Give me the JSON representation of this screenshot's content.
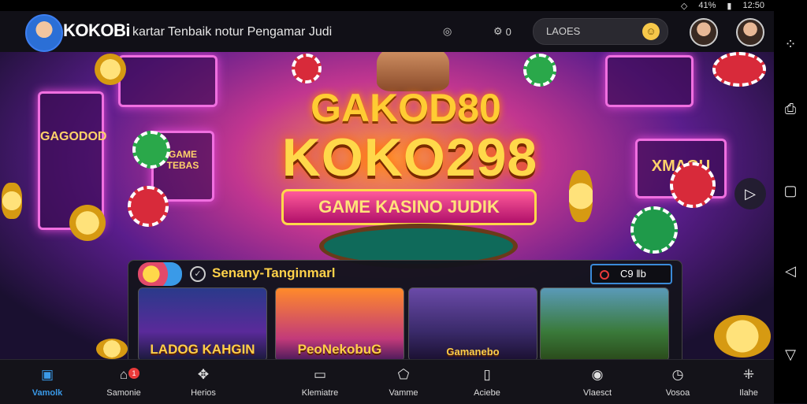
{
  "status": {
    "time": "12:50",
    "battery": "41%"
  },
  "header": {
    "brand": "KOKOBi",
    "tagline": "kartar Tenbaik notur Pengamar Judi",
    "icon1_name": "location-icon",
    "icon2_name": "settings-icon",
    "icon2_value": "0",
    "search_placeholder": "LAOES"
  },
  "hero": {
    "title_small": "GAKOD80",
    "title_big": "KOKO298",
    "subtitle": "GAME KASINO JUDIK",
    "sign_left": "GAGODOD",
    "sign_mid": "GAME TEBAS",
    "sign_right": "XMAGU"
  },
  "games": {
    "section_title": "Senany-Tanginmarl",
    "counter_text": "C9 ǁb",
    "cards": [
      {
        "label": "LADOG KAHGIN"
      },
      {
        "label": "PeoNekobuG"
      },
      {
        "label": "Gamanebo"
      },
      {
        "label": ""
      }
    ]
  },
  "nav": [
    {
      "label": "Vamolk",
      "icon": "home-icon",
      "active": true
    },
    {
      "label": "Samonie",
      "icon": "notification-icon",
      "badge": "1"
    },
    {
      "label": "Herios",
      "icon": "games-icon"
    },
    {
      "label": "Klemiatre",
      "icon": "chat-icon"
    },
    {
      "label": "Vamme",
      "icon": "bookmark-icon"
    },
    {
      "label": "Aciebe",
      "icon": "document-icon"
    },
    {
      "label": "Vlaesct",
      "icon": "user-icon"
    },
    {
      "label": "Vosoa",
      "icon": "clock-icon"
    },
    {
      "label": "Ilahe",
      "icon": "grid-icon"
    }
  ]
}
